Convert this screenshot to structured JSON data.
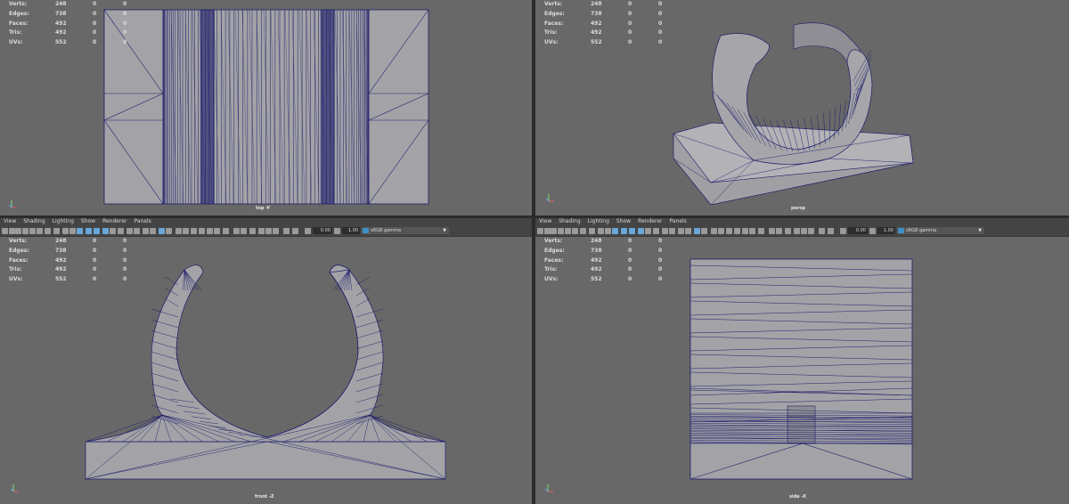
{
  "menu": [
    "View",
    "Shading",
    "Lighting",
    "Show",
    "Renderer",
    "Panels"
  ],
  "hud": {
    "labels": [
      "Verts:",
      "Edges:",
      "Faces:",
      "Tris:",
      "UVs:"
    ],
    "values": [
      [
        "248",
        "0",
        "0"
      ],
      [
        "738",
        "0",
        "0"
      ],
      [
        "492",
        "0",
        "0"
      ],
      [
        "492",
        "0",
        "0"
      ],
      [
        "552",
        "0",
        "0"
      ]
    ]
  },
  "viewports": {
    "top": {
      "camera": "top -Y"
    },
    "persp": {
      "camera": "persp"
    },
    "front": {
      "camera": "front -Z"
    },
    "side": {
      "camera": "side -X"
    }
  },
  "toolbar": {
    "exposure": "0.00",
    "gamma": "1.00",
    "colorspace": "sRGB gamma"
  },
  "colors": {
    "mesh_fill": "#a3a3a7",
    "wire": "#1e1c6a",
    "bg": "#686868"
  }
}
